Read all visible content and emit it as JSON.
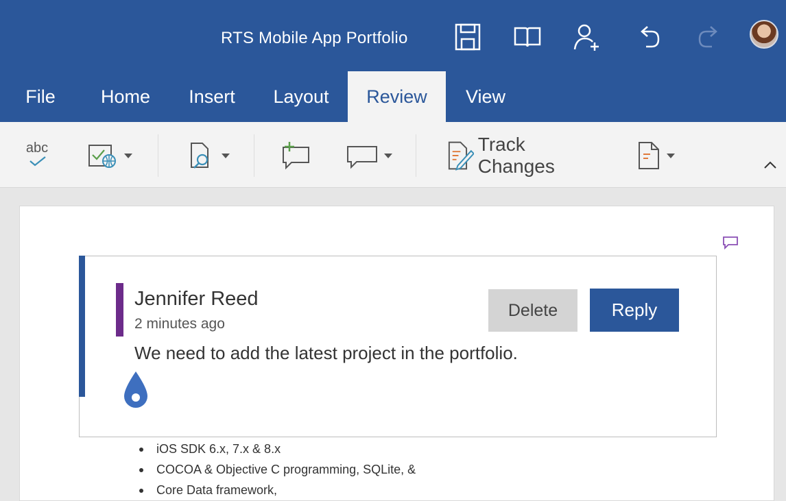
{
  "window": {
    "title": "RTS Mobile App Portfolio"
  },
  "titlebar_icons": [
    "save-icon",
    "read-mode-icon",
    "share-person-icon",
    "undo-icon",
    "redo-icon",
    "avatar"
  ],
  "tabs": [
    {
      "label": "File",
      "active": false
    },
    {
      "label": "Home",
      "active": false
    },
    {
      "label": "Insert",
      "active": false
    },
    {
      "label": "Layout",
      "active": false
    },
    {
      "label": "Review",
      "active": true
    },
    {
      "label": "View",
      "active": false
    }
  ],
  "ribbon": {
    "spelling_label": "abc",
    "track_changes_label": "Track Changes"
  },
  "comment": {
    "author": "Jennifer Reed",
    "timestamp": "2 minutes ago",
    "text": "We need to add the latest project in the portfolio.",
    "delete_label": "Delete",
    "reply_label": "Reply"
  },
  "document": {
    "bullets": [
      "iOS SDK 6.x, 7.x & 8.x",
      "COCOA & Objective C programming, SQLite, &",
      "Core Data framework,"
    ]
  },
  "colors": {
    "brand": "#2b579a",
    "author_accent": "#6c2b8a",
    "ribbon_bg": "#f3f3f3"
  }
}
